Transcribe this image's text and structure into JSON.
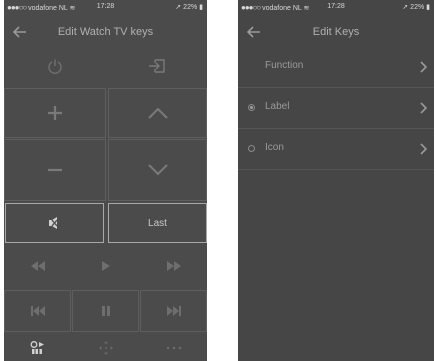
{
  "status": {
    "carrier": "vodafone NL",
    "time": "17:28",
    "battery": "22%"
  },
  "left_screen": {
    "title": "Edit Watch TV keys",
    "last_key_label": "Last",
    "icons": [
      "back-arrow-icon",
      "power-icon",
      "input-source-icon",
      "plus-icon",
      "chevron-up-icon",
      "minus-icon",
      "chevron-down-icon",
      "mute-icon",
      "rewind-icon",
      "play-icon",
      "fast-forward-icon",
      "skip-previous-icon",
      "pause-icon",
      "skip-next-icon",
      "record-play-icon",
      "dpad-icon",
      "more-icon"
    ]
  },
  "right_screen": {
    "title": "Edit Keys",
    "options": [
      {
        "label": "Function",
        "radio": null
      },
      {
        "label": "Label",
        "radio": "selected"
      },
      {
        "label": "Icon",
        "radio": "unselected"
      }
    ]
  },
  "colors": {
    "screen_bg": "#4b4b4b",
    "icon": "#7a7a7a",
    "highlight_border": "#a8a8a8"
  }
}
